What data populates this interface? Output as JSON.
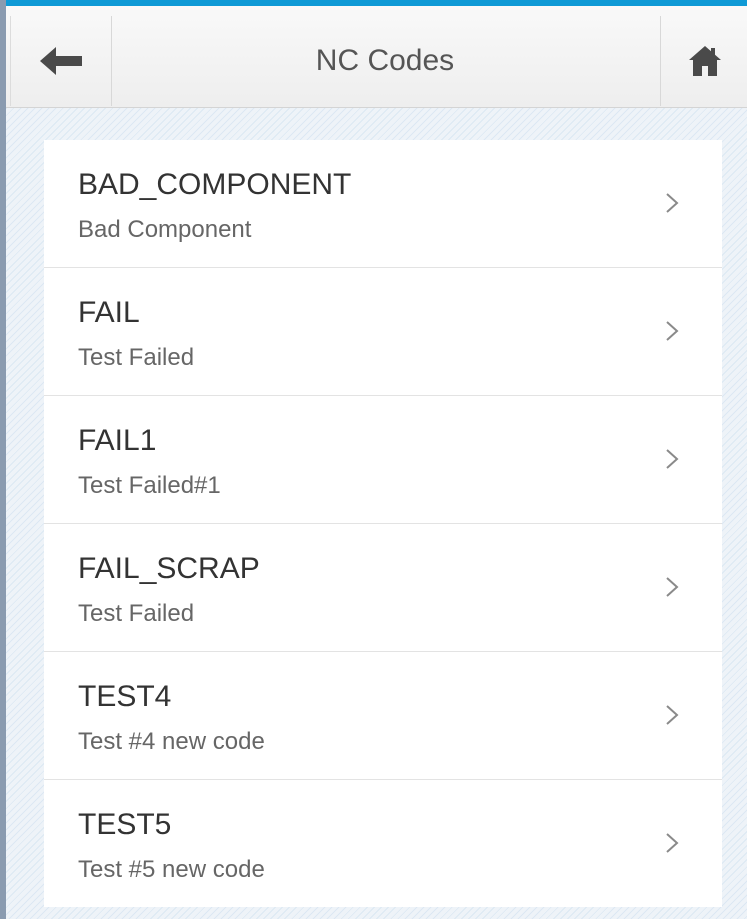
{
  "header": {
    "title": "NC Codes",
    "back_icon": "arrow-left-icon",
    "home_icon": "home-icon"
  },
  "colors": {
    "accent": "#0f9ad6",
    "header_bg": "#f2f2f2",
    "text_primary": "#333333",
    "text_secondary": "#666666"
  },
  "nc_codes": [
    {
      "code": "BAD_COMPONENT",
      "description": "Bad Component"
    },
    {
      "code": "FAIL",
      "description": "Test Failed"
    },
    {
      "code": "FAIL1",
      "description": "Test Failed#1"
    },
    {
      "code": "FAIL_SCRAP",
      "description": "Test Failed"
    },
    {
      "code": "TEST4",
      "description": "Test #4 new code"
    },
    {
      "code": "TEST5",
      "description": "Test #5 new code"
    }
  ]
}
